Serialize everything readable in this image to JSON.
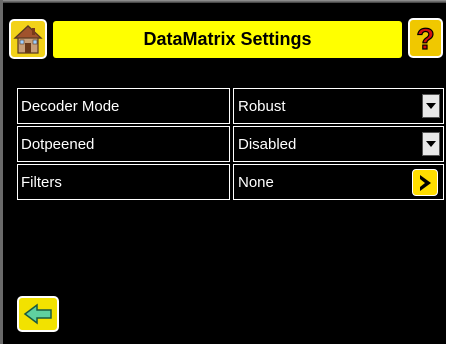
{
  "header": {
    "title": "DataMatrix Settings",
    "home_icon": "home-icon",
    "help_icon": "help-question-icon"
  },
  "settings": {
    "rows": [
      {
        "label": "Decoder Mode",
        "value": "Robust",
        "control": "dropdown"
      },
      {
        "label": "Dotpeened",
        "value": "Disabled",
        "control": "dropdown"
      },
      {
        "label": "Filters",
        "value": "None",
        "control": "navigate"
      }
    ]
  },
  "footer": {
    "back_icon": "back-arrow-icon"
  },
  "colors": {
    "background": "#000000",
    "title_bar": "#ffff00",
    "button_yellow": "#ffdd00",
    "text": "#ffffff"
  }
}
